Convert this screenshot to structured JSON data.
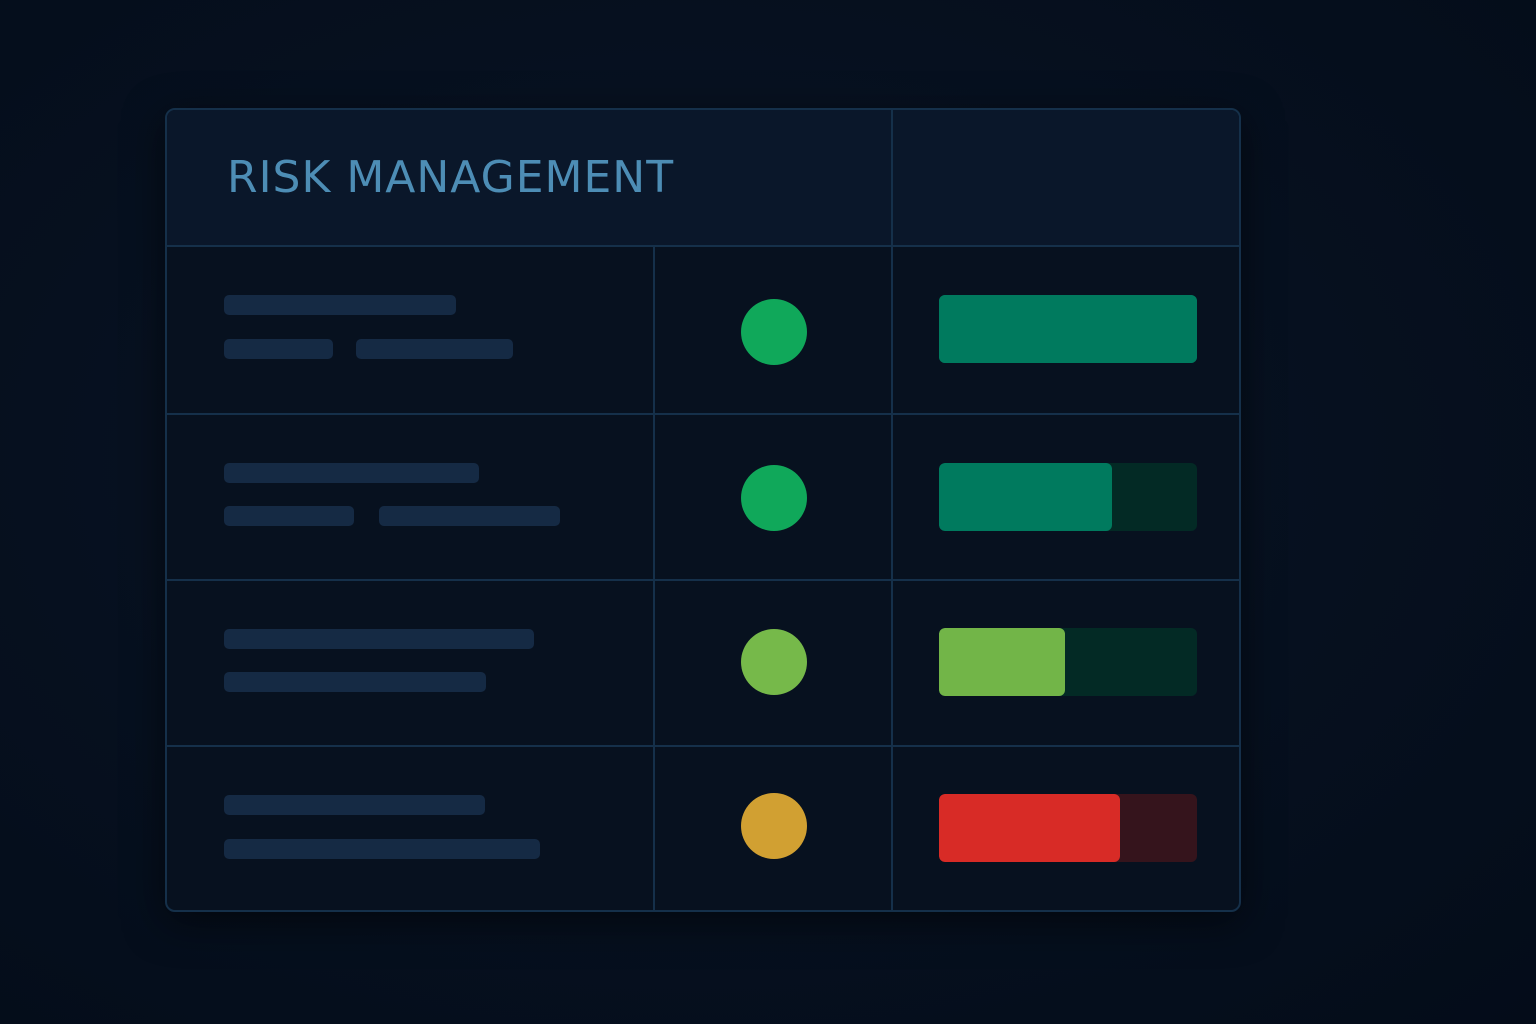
{
  "panel": {
    "title": "RISK MANAGEMENT"
  },
  "rows": [
    {
      "status_color": "#10a85a",
      "level": 1.0,
      "bar_color": "#007a5e",
      "track_color": "#007a5e"
    },
    {
      "status_color": "#10a85a",
      "level": 0.67,
      "bar_color": "#007a5e",
      "track_color": "#032a25"
    },
    {
      "status_color": "#76b94a",
      "level": 0.49,
      "bar_color": "#72b548",
      "track_color": "#032a25"
    },
    {
      "status_color": "#d1a032",
      "level": 0.7,
      "bar_color": "#d82b26",
      "track_color": "#35141c"
    }
  ]
}
